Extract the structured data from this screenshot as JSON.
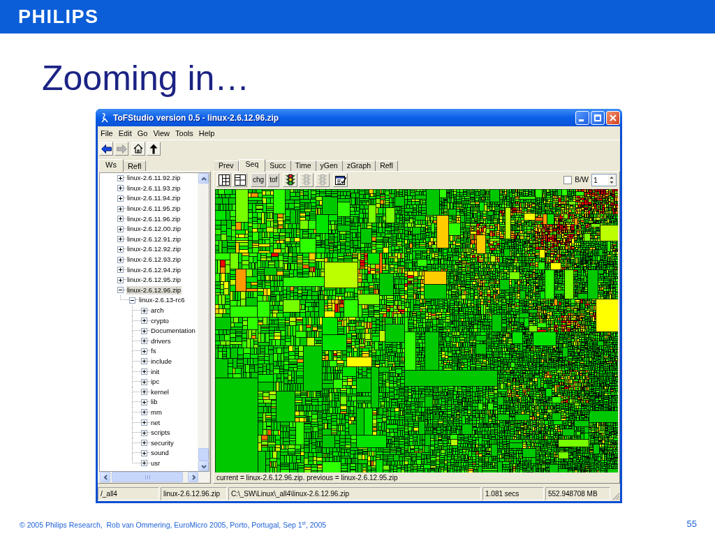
{
  "header": {
    "logo": "PHILIPS"
  },
  "slide_title": "Zooming in…",
  "window": {
    "title": "ToFStudio version 0.5 - linux-2.6.12.96.zip"
  },
  "menu": [
    "File",
    "Edit",
    "Go",
    "View",
    "Tools",
    "Help"
  ],
  "toolbar": [
    {
      "kind": "back",
      "disabled": false
    },
    {
      "kind": "forward",
      "disabled": true
    },
    {
      "kind": "home",
      "disabled": false
    },
    {
      "kind": "up",
      "disabled": false
    }
  ],
  "side_tabs": [
    {
      "label": "Ws",
      "selected": true
    },
    {
      "label": "Refl",
      "selected": false
    }
  ],
  "tree": [
    {
      "label": "linux-2.6.11.92.zip",
      "expanded": false,
      "selected": false
    },
    {
      "label": "linux-2.6.11.93.zip",
      "expanded": false,
      "selected": false
    },
    {
      "label": "linux-2.6.11.94.zip",
      "expanded": false,
      "selected": false
    },
    {
      "label": "linux-2.6.11.95.zip",
      "expanded": false,
      "selected": false
    },
    {
      "label": "linux-2.6.11.96.zip",
      "expanded": false,
      "selected": false
    },
    {
      "label": "linux-2.6.12.00.zip",
      "expanded": false,
      "selected": false
    },
    {
      "label": "linux-2.6.12.91.zip",
      "expanded": false,
      "selected": false
    },
    {
      "label": "linux-2.6.12.92.zip",
      "expanded": false,
      "selected": false
    },
    {
      "label": "linux-2.6.12.93.zip",
      "expanded": false,
      "selected": false
    },
    {
      "label": "linux-2.6.12.94.zip",
      "expanded": false,
      "selected": false
    },
    {
      "label": "linux-2.6.12.95.zip",
      "expanded": false,
      "selected": false
    },
    {
      "label": "linux-2.6.12.96.zip",
      "expanded": true,
      "selected": true,
      "children": [
        {
          "label": "linux-2.6.13-rc6",
          "expanded": true,
          "selected": false,
          "children": [
            {
              "label": "arch",
              "expanded": false,
              "selected": false
            },
            {
              "label": "crypto",
              "expanded": false,
              "selected": false
            },
            {
              "label": "Documentation",
              "expanded": false,
              "selected": false
            },
            {
              "label": "drivers",
              "expanded": false,
              "selected": false
            },
            {
              "label": "fs",
              "expanded": false,
              "selected": false
            },
            {
              "label": "include",
              "expanded": false,
              "selected": false
            },
            {
              "label": "init",
              "expanded": false,
              "selected": false
            },
            {
              "label": "ipc",
              "expanded": false,
              "selected": false
            },
            {
              "label": "kernel",
              "expanded": false,
              "selected": false
            },
            {
              "label": "lib",
              "expanded": false,
              "selected": false
            },
            {
              "label": "mm",
              "expanded": false,
              "selected": false
            },
            {
              "label": "net",
              "expanded": false,
              "selected": false
            },
            {
              "label": "scripts",
              "expanded": false,
              "selected": false
            },
            {
              "label": "security",
              "expanded": false,
              "selected": false
            },
            {
              "label": "sound",
              "expanded": false,
              "selected": false
            },
            {
              "label": "usr",
              "expanded": false,
              "selected": false
            }
          ]
        }
      ]
    }
  ],
  "view_tabs": [
    {
      "label": "Prev",
      "selected": false
    },
    {
      "label": "Seq",
      "selected": true
    },
    {
      "label": "Succ",
      "selected": false
    },
    {
      "label": "Time",
      "selected": false
    },
    {
      "label": "yGen",
      "selected": false
    },
    {
      "label": "zGraph",
      "selected": false
    },
    {
      "label": "Refl",
      "selected": false
    }
  ],
  "view_toolbar": {
    "buttons": [
      {
        "kind": "columns",
        "disabled": false
      },
      {
        "kind": "grid",
        "disabled": false
      },
      {
        "kind": "text",
        "label": "chg",
        "disabled": false
      },
      {
        "kind": "text",
        "label": "tof",
        "disabled": false
      },
      {
        "kind": "traffic-light",
        "disabled": false
      },
      {
        "kind": "traffic-light",
        "disabled": true
      },
      {
        "kind": "traffic-light",
        "disabled": true
      },
      {
        "kind": "properties",
        "disabled": false
      }
    ],
    "bw_checkbox": {
      "label": "B/W",
      "checked": false
    },
    "spin_field": {
      "value": "1"
    }
  },
  "status_line": "current = linux-2.6.12.96.zip. previous = linux-2.6.12.95.zip",
  "status_bar": [
    "/_all4",
    "linux-2.6.12.96.zip",
    "C:\\_SW\\Linux\\_all4\\linux-2.6.12.96.zip",
    "1.081 secs",
    "552.948708 MB"
  ],
  "footer": {
    "text": "© 2005 Philips Research,  Rob van Ommering, EuroMicro 2005, Porto, Portugal, Sep 1$^{st}$, 2005",
    "page": "55"
  }
}
